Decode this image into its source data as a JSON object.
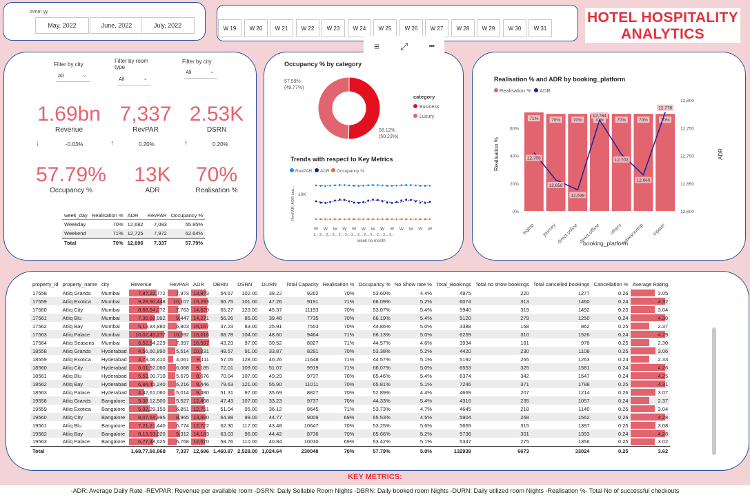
{
  "top_slicers": {
    "month_label": "mmm yy",
    "months": [
      "May, 2022",
      "June, 2022",
      "July, 2022"
    ],
    "weeks": [
      "W 19",
      "W 20",
      "W 21",
      "W 22",
      "W 23",
      "W 24",
      "W 25",
      "W 26",
      "W 27",
      "W 28",
      "W 29",
      "W 30",
      "W 31"
    ]
  },
  "title": {
    "line1": "HOTEL HOSPITALITY",
    "line2": "ANALYTICS"
  },
  "filters": [
    {
      "label": "Filter by city",
      "value": "All"
    },
    {
      "label": "Filter by room type",
      "value": "All"
    },
    {
      "label": "Filter by city",
      "value": "All"
    }
  ],
  "kpis": {
    "revenue": {
      "value": "1.69bn",
      "label": "Revenue",
      "change": "-0.03%"
    },
    "revpar": {
      "value": "7,337",
      "label": "RevPAR",
      "change": "0.20%"
    },
    "dsrn": {
      "value": "2.53K",
      "label": "DSRN",
      "change": "0.20%"
    },
    "occupancy": {
      "value": "57.79%",
      "label": "Occupancy %"
    },
    "adr": {
      "value": "13K",
      "label": "ADR"
    },
    "realisation": {
      "value": "70%",
      "label": "Realisation %"
    }
  },
  "day_table": {
    "headers": [
      "week_day",
      "Realisation %",
      "ADR",
      "RevPAR",
      "Occupancy %"
    ],
    "rows": [
      [
        "Weekday",
        "70%",
        "12,682",
        "7,083",
        "55.85%"
      ],
      [
        "Weekend",
        "71%",
        "12,725",
        "7,972",
        "62.64%"
      ]
    ],
    "total": [
      "Total",
      "70%",
      "12,696",
      "7,337",
      "57.79%"
    ]
  },
  "toolbar": {
    "filter_icon": "≡",
    "focus_icon": "⤢",
    "more_icon": "•••"
  },
  "donut": {
    "title": "Occupancy % by category",
    "legend_title": "category",
    "colors": {
      "Business": "#e3101f",
      "Luxury": "#e2646f"
    },
    "chart_data": {
      "type": "pie",
      "categories": [
        "Business",
        "Luxury"
      ],
      "values": [
        58.12,
        57.59
      ],
      "shares": [
        50.23,
        49.77
      ]
    },
    "labels": {
      "luxury": "57.59%",
      "luxury_pct": "(49.77%)",
      "business": "58.12%",
      "business_pct": "(50.23%)"
    }
  },
  "trends": {
    "title": "Trends with respect to Key Metrics",
    "legend": [
      "RevPAR",
      "ADR",
      "Occupancy %"
    ],
    "ylabel": "RevPAR, ADR and...",
    "xlabel": "week no month",
    "ytick": "10K",
    "xtick": "W",
    "xtick2": "1... 2... 2... 2... 2... 2... 2... 2... 2... 2... 2... 3... 3...",
    "colors": {
      "RevPAR": "#118dff",
      "ADR": "#12239e",
      "Occupancy %": "#e66c37"
    }
  },
  "platform_chart": {
    "title": "Realisation % and ADR by booking_platform",
    "legend": [
      "Realisation %",
      "ADR"
    ],
    "xlabel": "booking_platform",
    "ylabel_left": "Realisation %",
    "ylabel_right": "ADR",
    "left_ticks": [
      "0%",
      "20%",
      "40%",
      "60%"
    ],
    "right_ticks": [
      "12,600",
      "12,650",
      "12,700",
      "12,750",
      "12,800"
    ],
    "chart_data": {
      "type": "bar",
      "categories": [
        "logtrip",
        "journey",
        "direct online",
        "direct offline",
        "others",
        "makeyourtrip",
        "tripster"
      ],
      "series": [
        {
          "name": "Realisation %",
          "values": [
            71,
            70,
            70,
            70,
            70,
            70,
            70
          ]
        },
        {
          "name": "ADR",
          "values": [
            12705,
            12656,
            12638,
            12764,
            12702,
            12665,
            12778
          ]
        }
      ],
      "bar_labels": [
        "71%",
        "70%",
        "70%",
        "70%",
        "70%",
        "70%",
        "70%"
      ],
      "adr_labels": [
        "12,705",
        "12,656",
        "12,638",
        "12,764",
        "12,702",
        "12,665",
        "12,778"
      ]
    }
  },
  "property_table": {
    "headers": [
      "property_id",
      "property_name",
      "city",
      "Revenue",
      "RevPAR",
      "ADR",
      "DBRN",
      "DSRN",
      "DURN",
      "Total Capacity",
      "Realisation %",
      "Occupancy %",
      "No Show rate %",
      "Total_Bookings",
      "Total no show bookings",
      "Total cancelled bookings",
      "Cancellation %",
      "Average Rating"
    ],
    "rows": [
      [
        "17558",
        "Atliq Grands",
        "Mumbai",
        "7,8?,22,772",
        "7,9?3",
        "13,8?3",
        "54.67",
        "102.00",
        "38.22",
        "9262",
        "70%",
        "53.60%",
        "4.4%",
        "4975",
        "220",
        "1277",
        "0.26",
        "3.05"
      ],
      [
        "17559",
        "Atliq Exotica",
        "Mumbai",
        "9,28,90,448",
        "10,107",
        "15,293",
        "66.75",
        "101.00",
        "47.26",
        "9191",
        "71%",
        "66.09%",
        "5.2%",
        "6074",
        "313",
        "1460",
        "0.24",
        "4.32"
      ],
      [
        "17560",
        "Atliq City",
        "Mumbai",
        "8,68,94,072",
        "7,763",
        "14,629",
        "65.27",
        "123.00",
        "45.37",
        "11193",
        "70%",
        "53.07%",
        "5.4%",
        "5940",
        "319",
        "1492",
        "0.25",
        "3.04"
      ],
      [
        "17561",
        "Atliq Blu",
        "Mumbai",
        "7,30,68,992",
        "9,447",
        "14,271",
        "56.26",
        "85.00",
        "39.46",
        "7735",
        "70%",
        "66.19%",
        "5.4%",
        "5120",
        "279",
        "1250",
        "0.24",
        "4.30"
      ],
      [
        "17562",
        "Atliq Bay",
        "Mumbai",
        "5,13,84,880",
        "6,803",
        "15,167",
        "37.23",
        "83.00",
        "25.91",
        "7553",
        "70%",
        "44.86%",
        "5.0%",
        "3388",
        "168",
        "862",
        "0.25",
        "2.37"
      ],
      [
        "17563",
        "Atliq Palace",
        "Mumbai",
        "10,02,45,277",
        "10,592",
        "16,016",
        "68.78",
        "104.00",
        "48.60",
        "9464",
        "71%",
        "66.13%",
        "5.0%",
        "6259",
        "310",
        "1526",
        "0.24",
        "4.29"
      ],
      [
        "17564",
        "Atliq Seasons",
        "Mumbai",
        "6,52,94,229",
        "7,397",
        "16,597",
        "43.23",
        "97.00",
        "30.52",
        "8827",
        "71%",
        "44.57%",
        "4.6%",
        "3934",
        "181",
        "976",
        "0.25",
        "2.30"
      ],
      [
        "18558",
        "Atliq Grands",
        "Hyderabad",
        "4,56,60,890",
        "5,514",
        "10,331",
        "48.57",
        "91.00",
        "33.87",
        "8281",
        "70%",
        "53.38%",
        "5.2%",
        "4420",
        "230",
        "1108",
        "0.25",
        "3.06"
      ],
      [
        "18559",
        "Atliq Exotica",
        "Hyderabad",
        "4,73,06,410",
        "4,061",
        "9,111",
        "57.05",
        "128.00",
        "40.26",
        "11648",
        "71%",
        "44.57%",
        "5.1%",
        "5192",
        "265",
        "1263",
        "0.24",
        "2.33"
      ],
      [
        "18560",
        "Atliq City",
        "Hyderabad",
        "6,01,92,060",
        "6,068",
        "9,185",
        "72.01",
        "109.00",
        "51.07",
        "9919",
        "71%",
        "66.07%",
        "5.0%",
        "6553",
        "325",
        "1581",
        "0.24",
        "4.26"
      ],
      [
        "18561",
        "Atliq Blu",
        "Hyderabad",
        "5,53,00,710",
        "5,679",
        "8,676",
        "70.04",
        "107.00",
        "49.29",
        "9737",
        "70%",
        "65.46%",
        "5.4%",
        "6374",
        "342",
        "1547",
        "0.24",
        "4.25"
      ],
      [
        "18562",
        "Atliq Bay",
        "Hyderabad",
        "6,84,45,240",
        "6,216",
        "9,446",
        "79.63",
        "121.00",
        "55.90",
        "11011",
        "70%",
        "65.81%",
        "5.1%",
        "7246",
        "371",
        "1788",
        "0.25",
        "4.31"
      ],
      [
        "18563",
        "Atliq Palace",
        "Hyderabad",
        "4,42,61,060",
        "5,014",
        "9,480",
        "51.31",
        "97.00",
        "35.69",
        "8827",
        "70%",
        "52.89%",
        "4.4%",
        "4669",
        "207",
        "1214",
        "0.26",
        "3.07"
      ],
      [
        "19558",
        "Atliq Grands",
        "Bangalore",
        "5,38,12,500",
        "5,527",
        "12,468",
        "47.43",
        "107.00",
        "33.23",
        "9737",
        "70%",
        "44.33%",
        "5.4%",
        "4316",
        "235",
        "1057",
        "0.24",
        "2.37"
      ],
      [
        "19559",
        "Atliq Exotica",
        "Bangalore",
        "5,92,29,150",
        "6,851",
        "12,751",
        "51.04",
        "95.00",
        "36.12",
        "8645",
        "71%",
        "53.73%",
        "4.7%",
        "4645",
        "218",
        "1140",
        "0.25",
        "3.04"
      ],
      [
        "19560",
        "Atliq City",
        "Bangalore",
        "8,07,64,995",
        "8,965",
        "13,680",
        "64.88",
        "99.00",
        "44.77",
        "9009",
        "69%",
        "65.53%",
        "4.5%",
        "5904",
        "268",
        "1562",
        "0.26",
        "4.28"
      ],
      [
        "19561",
        "Atliq Blu",
        "Bangalore",
        "7,21,21,440",
        "6,774",
        "12,722",
        "62.30",
        "117.00",
        "43.48",
        "10647",
        "70%",
        "53.25%",
        "5.6%",
        "5669",
        "315",
        "1397",
        "0.25",
        "3.08"
      ],
      [
        "19562",
        "Atliq Bay",
        "Bangalore",
        "8,13,53,820",
        "9,312",
        "14,183",
        "63.03",
        "96.00",
        "44.42",
        "8736",
        "70%",
        "65.66%",
        "5.2%",
        "5736",
        "301",
        "1393",
        "0.24",
        "4.28"
      ],
      [
        "19563",
        "Atliq Palace",
        "Bangalore",
        "6,77,48,625",
        "6,768",
        "12,670",
        "58.76",
        "110.00",
        "40.84",
        "10010",
        "69%",
        "53.42%",
        "5.1%",
        "5347",
        "275",
        "1356",
        "0.25",
        "3.02"
      ]
    ],
    "total": [
      "Total",
      "",
      "",
      "1,68,77,60,868",
      "7,337",
      "12,696",
      "1,460.87",
      "2,528.00",
      "1,024.64",
      "230048",
      "70%",
      "57.79%",
      "5.0%",
      "132939",
      "6673",
      "33024",
      "0.25",
      "3.62"
    ]
  },
  "footer": {
    "title": "KEY METRICS:",
    "definitions": "-ADR:  Average Daily Rate  -REVPAR: Revenue per available room -DSRN: Daily Sellable Room Nights -DBRN: Daily booked room Nights -DURN:  Daily utilized room Nights -Realisation %- Total No of successful checkouts"
  }
}
